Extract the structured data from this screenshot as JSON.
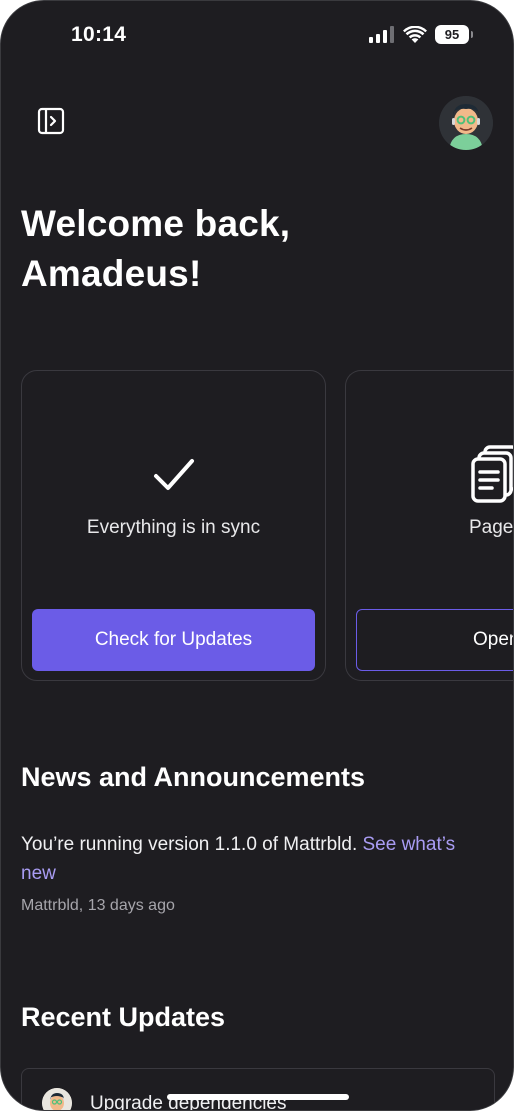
{
  "status_bar": {
    "time": "10:14",
    "battery": "95",
    "signal_icon": "cellular-signal-icon",
    "wifi_icon": "wifi-icon"
  },
  "header": {
    "sidebar_icon": "sidebar-toggle-icon",
    "avatar_icon": "user-avatar"
  },
  "welcome": {
    "line1": "Welcome back,",
    "line2": "Amadeus!"
  },
  "cards": [
    {
      "icon": "checkmark-icon",
      "text": "Everything is in sync",
      "button": "Check for Updates"
    },
    {
      "icon": "pages-icon",
      "text": "Pages",
      "button": "Open"
    }
  ],
  "news": {
    "title": "News and Announcements",
    "text": "You’re running version 1.1.0 of Mattrbld. ",
    "link": "See what’s new",
    "meta": "Mattrbld, 13 days ago"
  },
  "recent": {
    "title": "Recent Updates",
    "items": [
      {
        "text": "Upgrade dependencies"
      }
    ]
  },
  "colors": {
    "background": "#1e1d21",
    "accent": "#6b5ce7",
    "link": "#a99cf3"
  }
}
